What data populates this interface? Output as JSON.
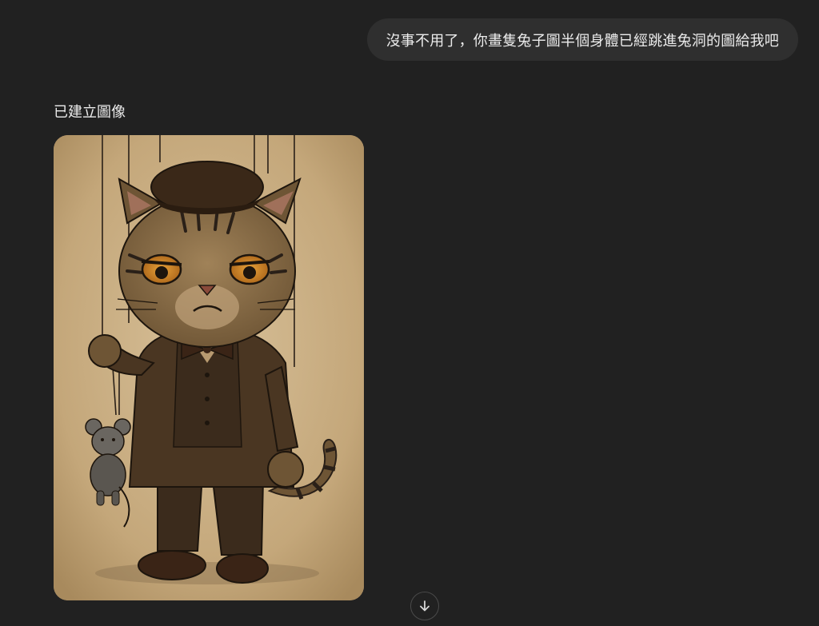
{
  "conversation": {
    "user_message": "沒事不用了，你畫隻兔子圖半個身體已經跳進兔洞的圖給我吧",
    "assistant_status": "已建立圖像"
  },
  "generated_image": {
    "subject_icon": "marionette-cat-holding-mouse-puppet-illustration"
  },
  "controls": {
    "scroll_down_icon": "arrow-down-icon"
  },
  "colors": {
    "background": "#212121",
    "bubble": "#2f2f2f",
    "text": "#ececec",
    "parchment": "#c9ad83"
  }
}
